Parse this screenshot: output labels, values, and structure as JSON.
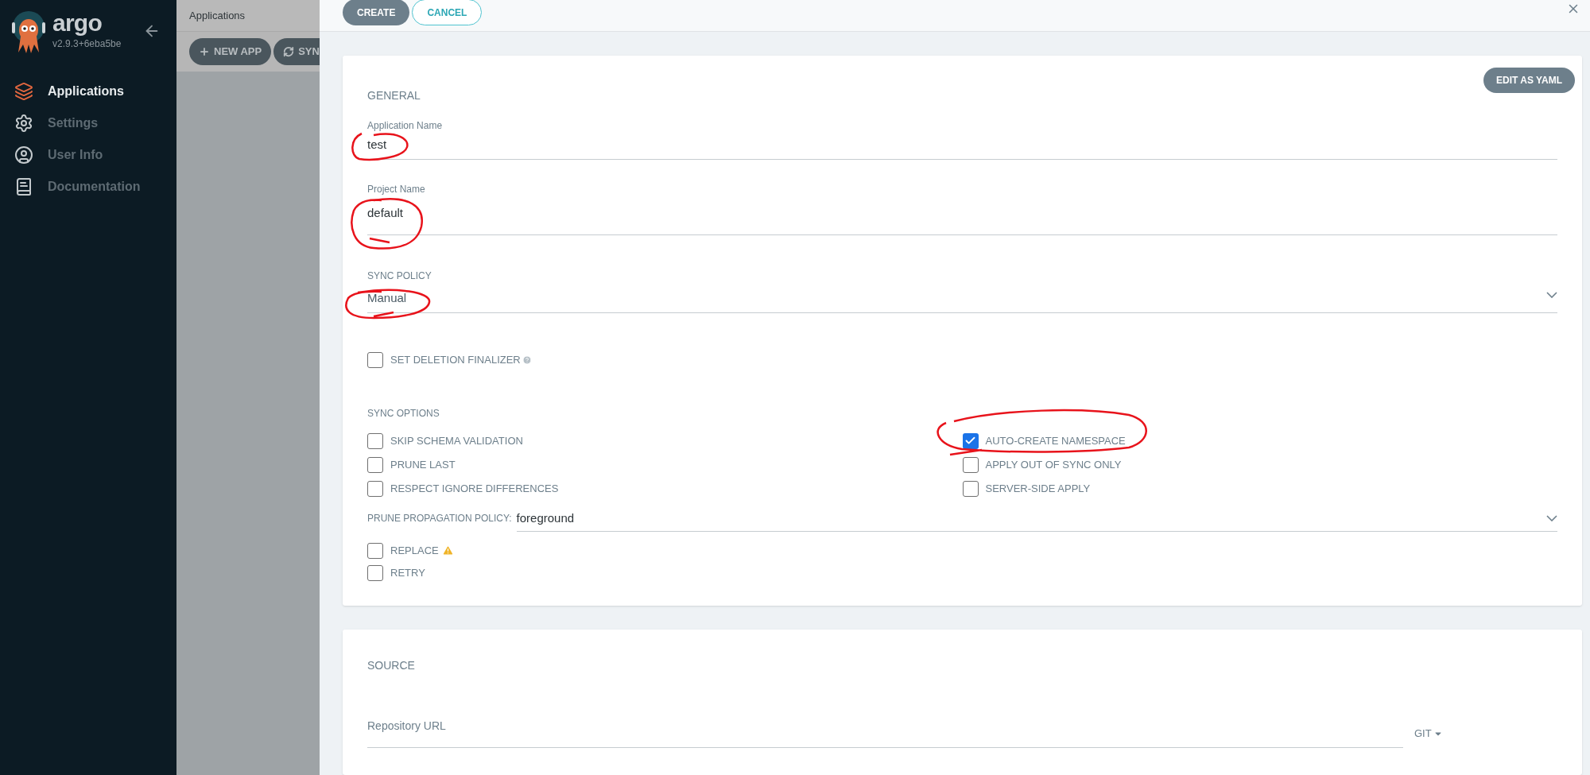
{
  "sidebar": {
    "logo_text": "argo",
    "version": "v2.9.3+6eba5be",
    "items": [
      {
        "label": "Applications",
        "selected": true
      },
      {
        "label": "Settings",
        "selected": false
      },
      {
        "label": "User Info",
        "selected": false
      },
      {
        "label": "Documentation",
        "selected": false
      }
    ]
  },
  "background_page": {
    "title": "Applications",
    "buttons": [
      {
        "label": "NEW APP"
      },
      {
        "label": "SYN"
      }
    ]
  },
  "panel": {
    "create_button": "CREATE",
    "cancel_button": "CANCEL",
    "general": {
      "title": "GENERAL",
      "edit_button": "EDIT AS YAML",
      "fields": [
        {
          "label": "Application Name",
          "value": "test"
        },
        {
          "label": "Project Name",
          "value": "default"
        }
      ],
      "sync_policy": {
        "label": "SYNC POLICY",
        "value": "Manual"
      },
      "deletion_finalizer": {
        "label": "SET DELETION FINALIZER",
        "checked": false
      },
      "sync_options": {
        "title": "SYNC OPTIONS",
        "left": [
          {
            "label": "SKIP SCHEMA VALIDATION",
            "checked": false
          },
          {
            "label": "PRUNE LAST",
            "checked": false
          },
          {
            "label": "RESPECT IGNORE DIFFERENCES",
            "checked": false
          }
        ],
        "right": [
          {
            "label": "AUTO-CREATE NAMESPACE",
            "checked": true
          },
          {
            "label": "APPLY OUT OF SYNC ONLY",
            "checked": false
          },
          {
            "label": "SERVER-SIDE APPLY",
            "checked": false
          }
        ]
      },
      "prune_propagation": {
        "label": "PRUNE PROPAGATION POLICY:",
        "value": "foreground"
      },
      "extra_options": [
        {
          "label": "REPLACE",
          "checked": false,
          "warning": true
        },
        {
          "label": "RETRY",
          "checked": false,
          "warning": false
        }
      ]
    },
    "source": {
      "title": "SOURCE",
      "repository_url": {
        "label": "Repository URL"
      },
      "type": "GIT"
    }
  }
}
